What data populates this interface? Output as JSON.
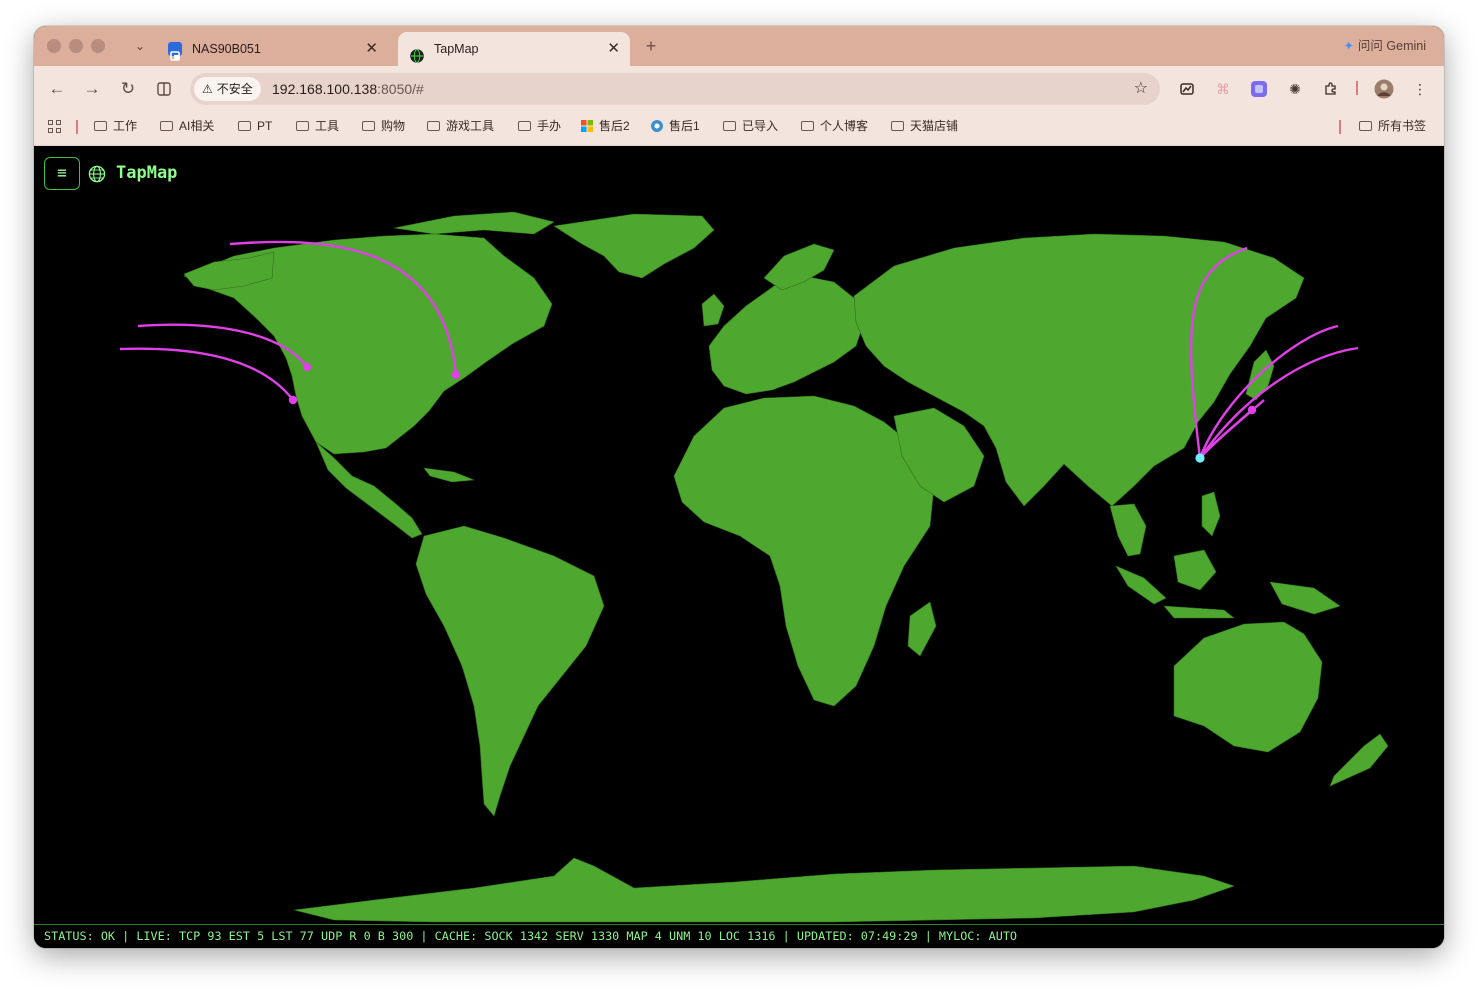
{
  "browser": {
    "tabs": [
      {
        "title": "NAS90B051",
        "active": false
      },
      {
        "title": "TapMap",
        "active": true
      }
    ],
    "gemini_label": "问问 Gemini",
    "security_label": "不安全",
    "url_host": "192.168.100.138",
    "url_rest": ":8050/#",
    "bookmarks": [
      "工作",
      "AI相关",
      "PT",
      "工具",
      "购物",
      "游戏工具",
      "手办",
      "售后2",
      "售后1",
      "已导入",
      "个人博客",
      "天猫店铺"
    ],
    "all_bookmarks": "所有书签"
  },
  "app": {
    "title": "TapMap",
    "menu_icon": "hamburger-icon",
    "status_text": "STATUS: OK | LIVE: TCP 93 EST 5 LST 77 UDP R 0 B 300 | CACHE: SOCK 1342 SERV 1330 MAP 4 UNM 10 LOC 1316 | UPDATED: 07:49:29 | MYLOC: AUTO"
  },
  "colors": {
    "land": "#4ea72e",
    "ocean": "#000000",
    "arc": "#e040e8",
    "origin": "#6ff0ff",
    "accent": "#8dff8d"
  }
}
